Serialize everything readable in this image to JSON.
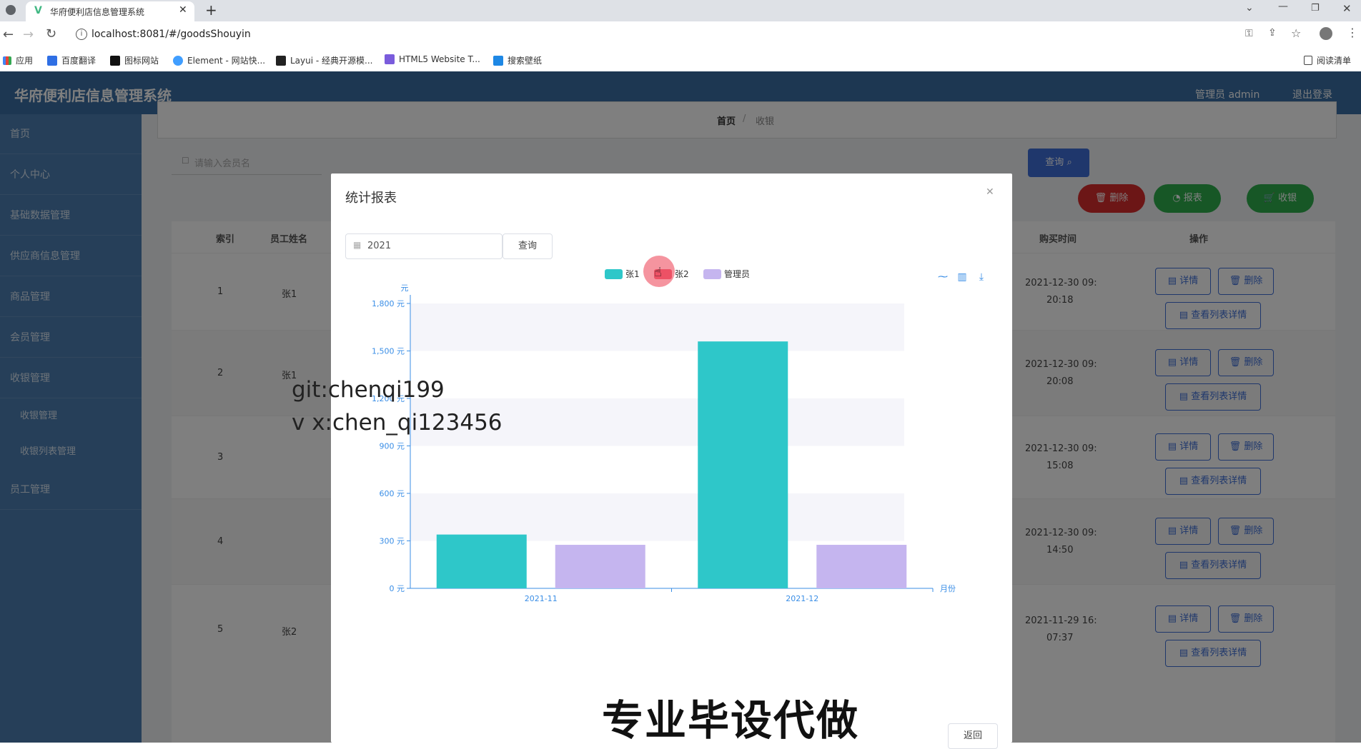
{
  "browser": {
    "tab_title": "华府便利店信息管理系统",
    "url": "localhost:8081/#/goodsShouyin",
    "bookmarks": [
      "应用",
      "百度翻译",
      "图标网站",
      "Element - 网站快...",
      "Layui - 经典开源模...",
      "HTML5 Website T...",
      "搜索壁纸"
    ],
    "reading_list": "阅读清单"
  },
  "app": {
    "title": "华府便利店信息管理系统",
    "user_label": "管理员 admin",
    "logout": "退出登录",
    "breadcrumb": {
      "home": "首页",
      "sep": "/",
      "current": "收银"
    },
    "sidebar": [
      "首页",
      "个人中心",
      "基础数据管理",
      "供应商信息管理",
      "商品管理",
      "会员管理",
      "收银管理",
      "收银管理",
      "收银列表管理",
      "员工管理"
    ],
    "search_placeholder": "请输入会员名",
    "query_button": "查询",
    "actions": {
      "delete": "删除",
      "report": "报表",
      "checkout": "收银"
    },
    "table": {
      "headers": {
        "index": "索引",
        "name": "员工姓名",
        "time": "购买时间",
        "ops": "操作"
      },
      "rows": [
        {
          "index": "1",
          "name": "张1",
          "time1": "2021-12-30 09:",
          "time2": "20:18"
        },
        {
          "index": "2",
          "name": "张1",
          "time1": "2021-12-30 09:",
          "time2": "20:08"
        },
        {
          "index": "3",
          "name": "",
          "time1": "2021-12-30 09:",
          "time2": "15:08"
        },
        {
          "index": "4",
          "name": "",
          "time1": "2021-12-30 09:",
          "time2": "14:50"
        },
        {
          "index": "5",
          "name": "张2",
          "time1": "2021-11-29 16:",
          "time2": "07:37"
        }
      ],
      "row_buttons": {
        "detail": "详情",
        "delete": "删除",
        "list_detail": "查看列表详情"
      }
    }
  },
  "modal": {
    "title": "统计报表",
    "year_value": "2021",
    "query": "查询",
    "back": "返回"
  },
  "chart_data": {
    "type": "bar",
    "categories": [
      "2021-11",
      "2021-12"
    ],
    "series": [
      {
        "name": "张1",
        "values": [
          340,
          1560
        ],
        "color": "#2ec7c9"
      },
      {
        "name": "张2",
        "values": [
          null,
          null
        ],
        "color": "#ed6a7f"
      },
      {
        "name": "管理员",
        "values": [
          275,
          275
        ],
        "color": "#c5b5ef"
      }
    ],
    "ylim": [
      0,
      1800
    ],
    "yticks": [
      "0 元",
      "300 元",
      "600 元",
      "900 元",
      "1,200 元",
      "1,500 元",
      "1,800 元"
    ],
    "yunit": "元",
    "xlabel": "月份",
    "legend_position": "top-center",
    "toolbox": [
      "line-icon",
      "bar-icon",
      "download-icon"
    ]
  },
  "watermarks": {
    "git": "git:chenqi199",
    "vx": "v x:chen_qi123456",
    "banner": "专业毕设代做"
  }
}
